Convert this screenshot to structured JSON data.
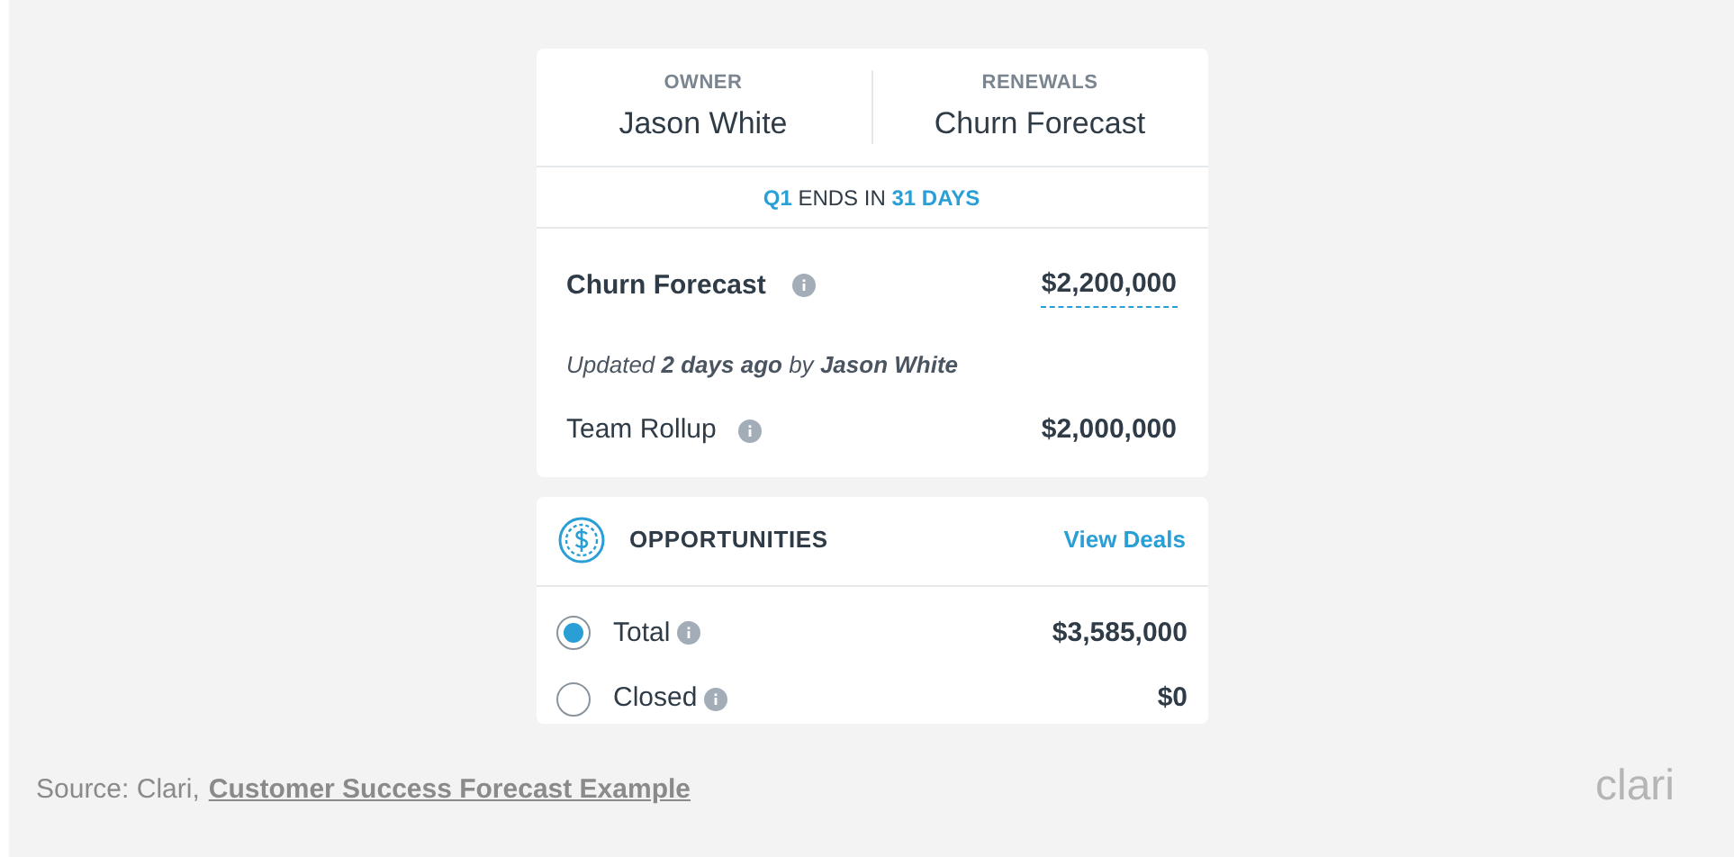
{
  "header": {
    "columns": [
      {
        "label": "OWNER",
        "value": "Jason White"
      },
      {
        "label": "RENEWALS",
        "value": "Churn Forecast"
      }
    ]
  },
  "quarter_banner": "**Q1** ENDS IN **31 DAYS**",
  "forecast": {
    "label": "Churn Forecast",
    "value": "$2,200,000",
    "updated": "Updated **2 days ago** by **Jason White**",
    "rollup_label": "Team Rollup",
    "rollup_value": "$2,000,000"
  },
  "opportunities": {
    "title": "OPPORTUNITIES",
    "link": "View Deals",
    "rows": [
      {
        "label": "Total",
        "value": "$3,585,000",
        "selected": true
      },
      {
        "label": "Closed",
        "value": "$0",
        "selected": false
      }
    ]
  },
  "source": {
    "prefix": "Source: Clari,",
    "link": "Customer Success Forecast Example"
  },
  "logo": "clari"
}
